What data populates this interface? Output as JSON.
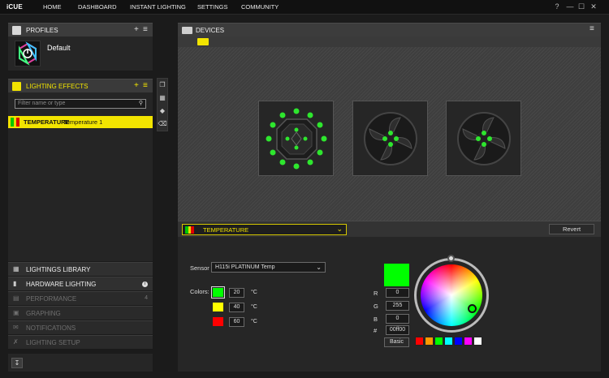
{
  "app": {
    "title": "iCUE"
  },
  "nav": [
    "HOME",
    "DASHBOARD",
    "INSTANT LIGHTING",
    "SETTINGS",
    "COMMUNITY"
  ],
  "window_controls": {
    "help": "?",
    "minimize": "—",
    "maximize": "☐",
    "close": "✕"
  },
  "profiles": {
    "title": "PROFILES",
    "add": "+",
    "menu": "≡",
    "items": [
      {
        "name": "Default"
      }
    ]
  },
  "lighting_effects": {
    "title": "LIGHTING EFFECTS",
    "add": "+",
    "menu": "≡",
    "filter_placeholder": "Filter name or type",
    "effects": [
      {
        "type": "TEMPERATURE",
        "name": "Temperature 1",
        "swatch": [
          "#00c800",
          "#e8d800",
          "#e00000"
        ]
      }
    ],
    "tools": [
      "copy-icon",
      "duplicate-icon",
      "move-icon",
      "delete-icon"
    ]
  },
  "library": {
    "lighting_library": "LIGHTINGS LIBRARY",
    "hardware_lighting": "HARDWARE LIGHTING",
    "hardware_info": "i",
    "performance": "PERFORMANCE",
    "performance_count": "4",
    "graphing": "GRAPHING",
    "notifications": "NOTIFICATIONS",
    "lighting_setup": "LIGHTING SETUP"
  },
  "devices": {
    "title": "DEVICES",
    "menu": "≡"
  },
  "effect_editor": {
    "selected": "TEMPERATURE",
    "revert": "Revert",
    "sensor_label": "Sensor",
    "sensor_value": "H115i PLATINUM Temp",
    "colors_label": "Colors:",
    "stops": [
      {
        "color": "#00ff00",
        "temp": "20",
        "unit": "°C"
      },
      {
        "color": "#ffff00",
        "temp": "40",
        "unit": "°C"
      },
      {
        "color": "#ff0000",
        "temp": "60",
        "unit": "°C"
      }
    ],
    "r_label": "R",
    "r": "0",
    "g_label": "G",
    "g": "255",
    "b_label": "B",
    "b": "0",
    "hex_label": "#",
    "hex": "00ff00",
    "basic": "Basic",
    "presets": [
      "#ff0000",
      "#ff9900",
      "#00ff00",
      "#00ffff",
      "#0000ff",
      "#ff00ff",
      "#ffffff"
    ]
  },
  "colors": {
    "accent": "#f2e400",
    "led_on": "#22ee22"
  }
}
